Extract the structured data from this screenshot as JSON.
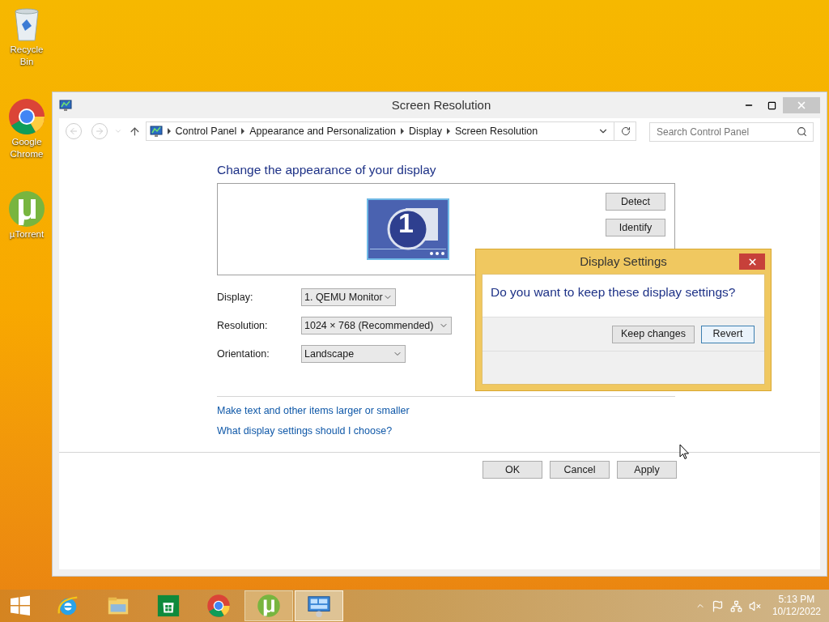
{
  "desktop_icons": [
    {
      "kind": "recycle",
      "label": "Recycle Bin"
    },
    {
      "kind": "chrome",
      "label": "Google Chrome"
    },
    {
      "kind": "utorrent",
      "label": "µTorrent"
    }
  ],
  "window": {
    "title": "Screen Resolution",
    "breadcrumb": [
      "Control Panel",
      "Appearance and Personalization",
      "Display",
      "Screen Resolution"
    ],
    "search": {
      "placeholder": "Search Control Panel"
    },
    "heading": "Change the appearance of your display",
    "monitor_number": "1",
    "side_buttons": [
      "Detect",
      "Identify"
    ],
    "fields": [
      {
        "label": "Display:",
        "value": "1. QEMU Monitor"
      },
      {
        "label": "Resolution:",
        "value": "1024 × 768 (Recommended)"
      },
      {
        "label": "Orientation:",
        "value": "Landscape"
      }
    ],
    "links": [
      "Make text and other items larger or smaller",
      "What display settings should I choose?"
    ],
    "buttons": [
      "OK",
      "Cancel",
      "Apply"
    ]
  },
  "dialog": {
    "title": "Display Settings",
    "question": "Do you want to keep these display settings?",
    "buttons": [
      {
        "label": "Keep changes",
        "selected": false
      },
      {
        "label": "Revert",
        "selected": true
      }
    ]
  },
  "taskbar": {
    "apps": [
      {
        "kind": "ie",
        "highlighted": false
      },
      {
        "kind": "explorer",
        "highlighted": false
      },
      {
        "kind": "store",
        "highlighted": false
      },
      {
        "kind": "chrome",
        "highlighted": false
      },
      {
        "kind": "utorrent",
        "highlighted": true
      },
      {
        "kind": "control",
        "highlighted": true
      }
    ],
    "time": "5:13 PM",
    "date": "10/12/2022"
  }
}
